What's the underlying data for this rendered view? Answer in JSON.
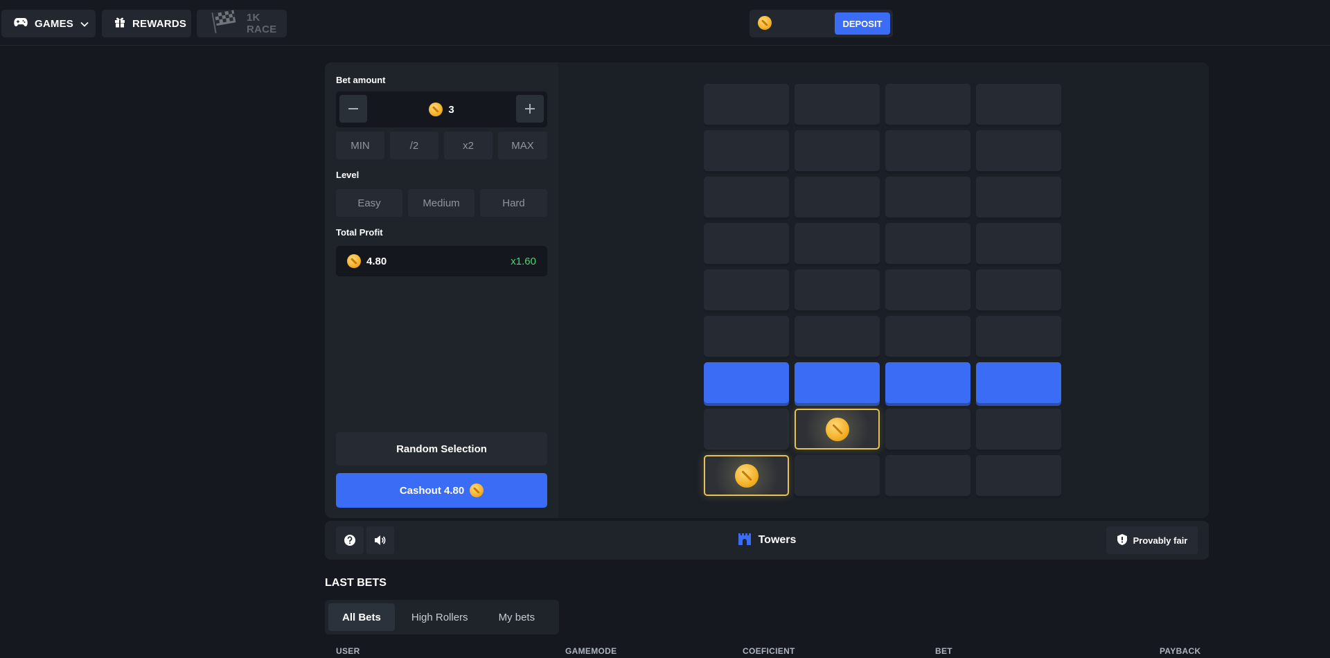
{
  "nav": {
    "games_label": "GAMES",
    "rewards_label": "REWARDS",
    "race_label": "1K RACE"
  },
  "wallet": {
    "deposit_label": "DEPOSIT"
  },
  "bet": {
    "section_label": "Bet amount",
    "amount": "3",
    "quick": [
      "MIN",
      "/2",
      "x2",
      "MAX"
    ]
  },
  "level": {
    "section_label": "Level",
    "options": [
      "Easy",
      "Medium",
      "Hard"
    ]
  },
  "profit": {
    "section_label": "Total Profit",
    "amount": "4.80",
    "multiplier": "x1.60"
  },
  "actions": {
    "random_label": "Random Selection",
    "cashout_label": "Cashout 4.80"
  },
  "board": {
    "columns": 4,
    "rows": 9,
    "active_row": 7,
    "picks": [
      {
        "row": 8,
        "col": 2
      },
      {
        "row": 9,
        "col": 1
      }
    ]
  },
  "footer": {
    "game_name": "Towers",
    "fair_label": "Provably fair"
  },
  "last_bets": {
    "title": "LAST BETS",
    "tabs": [
      "All Bets",
      "High Rollers",
      "My bets"
    ],
    "active_tab": 0,
    "columns": [
      "USER",
      "GAMEMODE",
      "COEFICIENT",
      "BET",
      "PAYBACK"
    ]
  },
  "colors": {
    "accent": "#3b6cf6",
    "multiplier": "#4ad46b",
    "coin": "#f5b52e"
  }
}
